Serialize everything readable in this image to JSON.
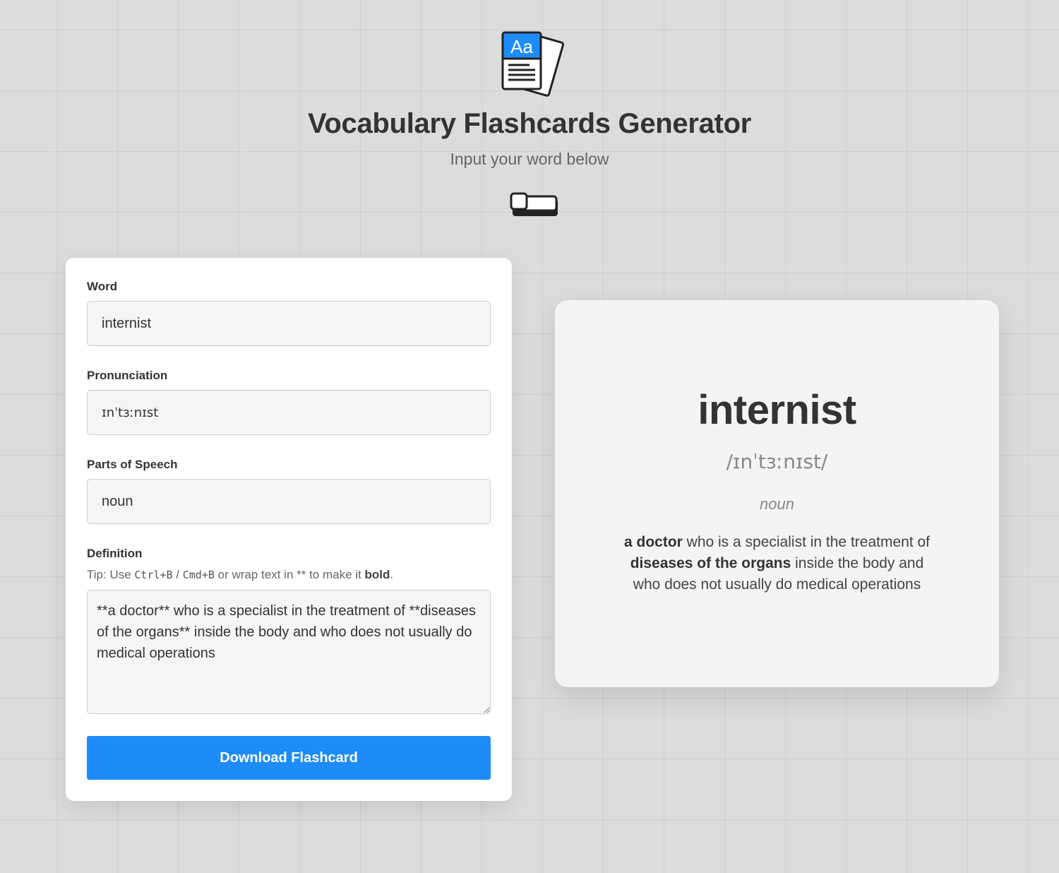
{
  "header": {
    "title": "Vocabulary Flashcards Generator",
    "subtitle": "Input your word below",
    "logo_icon": "flashcards-aa-icon",
    "logo_text": "Aa",
    "toggle_icon": "theme-toggle-icon"
  },
  "form": {
    "word": {
      "label": "Word",
      "value": "internist"
    },
    "pronunciation": {
      "label": "Pronunciation",
      "value": "ɪnˈtɜːnɪst"
    },
    "parts_of_speech": {
      "label": "Parts of Speech",
      "value": "noun"
    },
    "definition": {
      "label": "Definition",
      "tip_prefix": "Tip: Use ",
      "tip_key1": "Ctrl+B",
      "tip_sep": " / ",
      "tip_key2": "Cmd+B",
      "tip_middle": " or wrap text in ** to make it ",
      "tip_bold": "bold",
      "tip_end": ".",
      "value": "**a doctor** who is a specialist in the treatment of **diseases of the organs** inside the body and who does not usually do medical operations"
    },
    "download_label": "Download Flashcard"
  },
  "card": {
    "word": "internist",
    "pronunciation": "/ɪnˈtɜːnɪst/",
    "part_of_speech": "noun",
    "definition_parts": [
      {
        "text": "a doctor",
        "bold": true
      },
      {
        "text": " who is a specialist in the treatment of ",
        "bold": false
      },
      {
        "text": "diseases of the organs",
        "bold": true
      },
      {
        "text": " inside the body and who does not usually do medical operations",
        "bold": false
      }
    ]
  },
  "colors": {
    "accent": "#1e8cf8",
    "background": "#dcdcdc",
    "card": "#f4f4f2"
  }
}
